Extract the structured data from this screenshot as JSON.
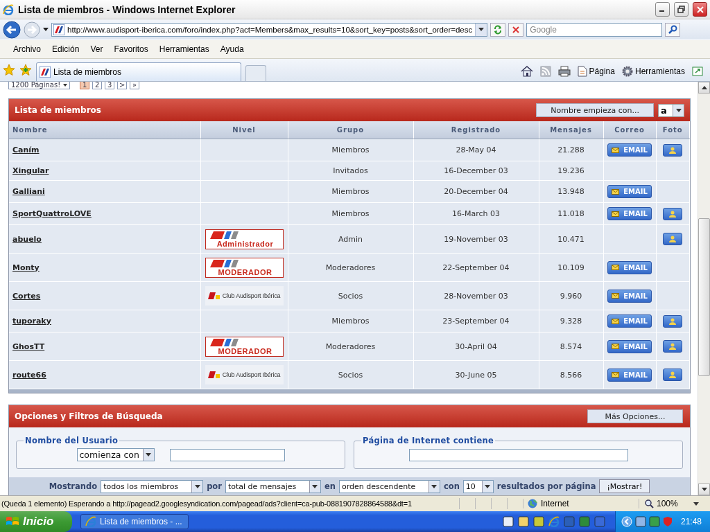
{
  "window": {
    "title": "Lista de miembros - Windows Internet Explorer"
  },
  "address_bar": {
    "url": "http://www.audisport-iberica.com/foro/index.php?act=Members&max_results=10&sort_key=posts&sort_order=desc",
    "search_placeholder": "Google"
  },
  "menu": [
    "Archivo",
    "Edición",
    "Ver",
    "Favoritos",
    "Herramientas",
    "Ayuda"
  ],
  "tabs": [
    {
      "label": "Lista de miembros",
      "selected": true
    }
  ],
  "command_bar": {
    "page": "Página",
    "tools": "Herramientas"
  },
  "pager": {
    "pages_label": "1200 Páginas!",
    "pages": [
      {
        "label": "1",
        "selected": true
      },
      {
        "label": "2",
        "selected": false
      },
      {
        "label": "3",
        "selected": false
      },
      {
        "label": ">",
        "selected": false
      },
      {
        "label": "»",
        "selected": false
      }
    ]
  },
  "members": {
    "title": "Lista de miembros",
    "filter_label": "Nombre empieza con...",
    "filter_letter": "a",
    "columns": [
      "Nombre",
      "Nivel",
      "Grupo",
      "Registrado",
      "Mensajes",
      "Correo",
      "Foto"
    ],
    "rows": [
      {
        "name": "Caním",
        "group": "Miembros",
        "registered": "28-May 04",
        "posts": "21.288",
        "email": "EMAIL",
        "photo": true
      },
      {
        "name": "Xingular",
        "group": "Invitados",
        "registered": "16-December 03",
        "posts": "19.236",
        "photo": false
      },
      {
        "name": "Galliani",
        "group": "Miembros",
        "registered": "20-December 04",
        "posts": "13.948",
        "email": "EMAIL",
        "photo": false
      },
      {
        "name": "SportQuattroLOVE",
        "group": "Miembros",
        "registered": "16-March 03",
        "posts": "11.018",
        "email": "EMAIL",
        "photo": true
      },
      {
        "name": "abuelo",
        "rank": {
          "kind": "staff",
          "label": "Administrador"
        },
        "group": "Admin",
        "registered": "19-November 03",
        "posts": "10.471",
        "photo": true
      },
      {
        "name": "Monty",
        "rank": {
          "kind": "staff",
          "label": "MODERADOR"
        },
        "group": "Moderadores",
        "registered": "22-September 04",
        "posts": "10.109",
        "email": "EMAIL",
        "photo": false
      },
      {
        "name": "Cortes",
        "rank": {
          "kind": "club",
          "label": "Club Audisport Ibérica"
        },
        "group": "Socios",
        "registered": "28-November 03",
        "posts": "9.960",
        "email": "EMAIL",
        "photo": false
      },
      {
        "name": "tuporaky",
        "group": "Miembros",
        "registered": "23-September 04",
        "posts": "9.328",
        "email": "EMAIL",
        "photo": true
      },
      {
        "name": "GhosTT",
        "rank": {
          "kind": "staff",
          "label": "MODERADOR"
        },
        "group": "Moderadores",
        "registered": "30-April 04",
        "posts": "8.574",
        "email": "EMAIL",
        "photo": true
      },
      {
        "name": "route66",
        "rank": {
          "kind": "club",
          "label": "Club Audisport Ibérica"
        },
        "group": "Socios",
        "registered": "30-June 05",
        "posts": "8.566",
        "email": "EMAIL",
        "photo": true
      }
    ]
  },
  "options": {
    "title": "Opciones y Filtros de Búsqueda",
    "more_button": "Más Opciones...",
    "username": {
      "legend": "Nombre del Usuario",
      "mode": "comienza con"
    },
    "website": {
      "legend": "Página de Internet contiene"
    },
    "display": {
      "showing": "Mostrando",
      "members": "todos los miembros",
      "by": "por",
      "sort": "total de mensajes",
      "in": "en",
      "order": "orden descendente",
      "with": "con",
      "count": "10",
      "per_page": "resultados por página",
      "button": "¡Mostrar!"
    }
  },
  "status_bar": {
    "text": "(Queda 1 elemento) Esperando a http://pagead2.googlesyndication.com/pagead/ads?client=ca-pub-0881907828864588&dt=1",
    "zone": "Internet",
    "zoom": "100%"
  },
  "taskbar": {
    "start": "Inicio",
    "tasks": [
      "Lista de miembros - ..."
    ],
    "clock": "21:48"
  }
}
